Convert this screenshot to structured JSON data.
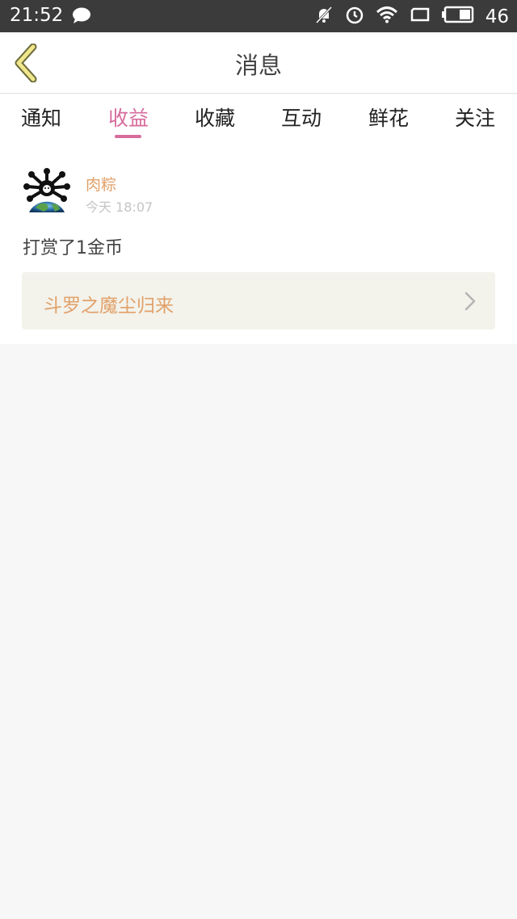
{
  "status_bar": {
    "time": "21:52",
    "battery": "46",
    "icons": [
      "chat-bubble-icon",
      "muted-bell-icon",
      "alarm-icon",
      "wifi-icon",
      "rotate-icon",
      "battery-icon"
    ]
  },
  "header": {
    "title": "消息",
    "back_icon": "back-chevron-icon"
  },
  "tabs": [
    {
      "label": "通知",
      "active": false
    },
    {
      "label": "收益",
      "active": true
    },
    {
      "label": "收藏",
      "active": false
    },
    {
      "label": "互动",
      "active": false
    },
    {
      "label": "鲜花",
      "active": false
    },
    {
      "label": "关注",
      "active": false
    }
  ],
  "message": {
    "username": "肉粽",
    "timestamp": "今天 18:07",
    "text": "打赏了1金币",
    "book_title": "斗罗之魔尘归来"
  },
  "colors": {
    "accent": "#d76b9c",
    "username": "#e1a169",
    "status_bar": "#3b3b3b",
    "back_icon": "#f0e68c"
  }
}
